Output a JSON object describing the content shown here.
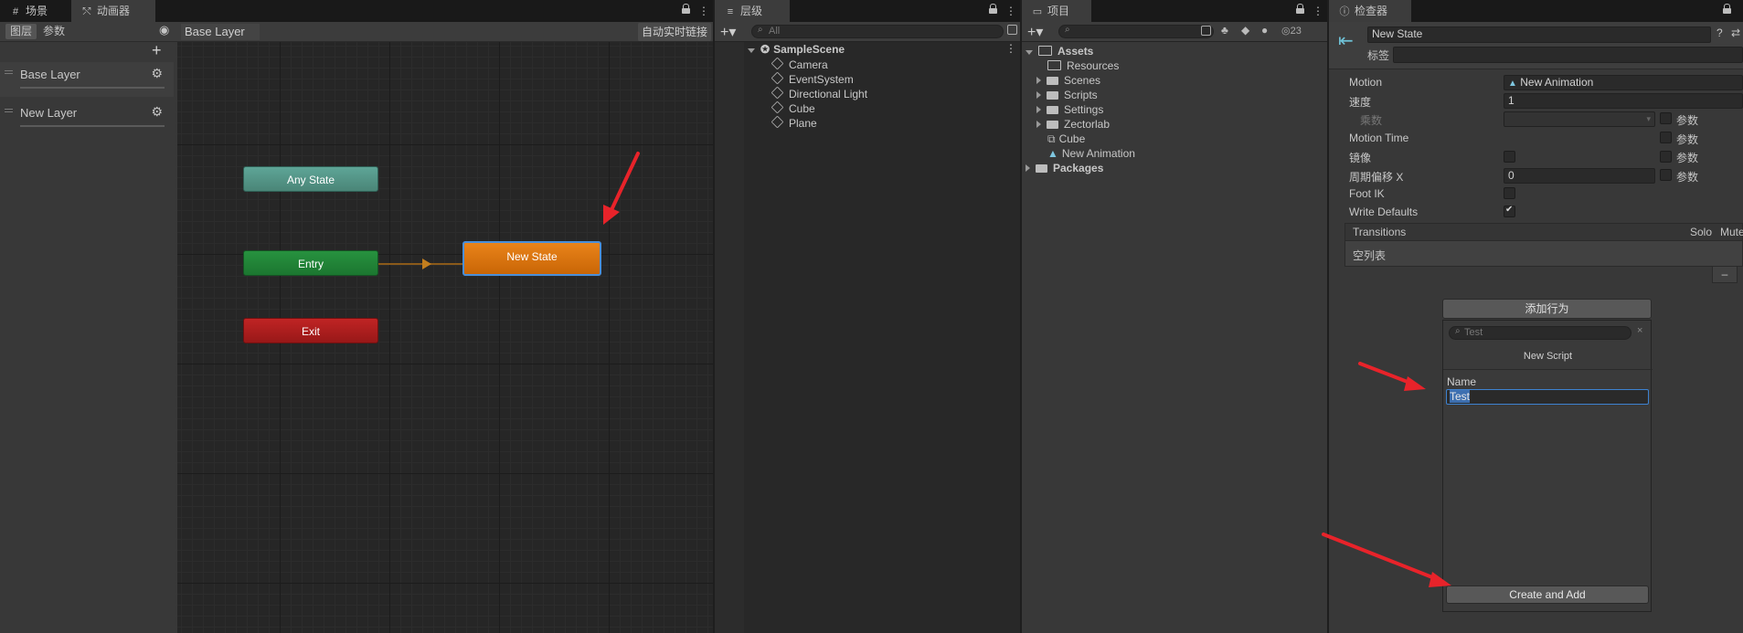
{
  "tabs": {
    "scene": "场景",
    "animator": "动画器",
    "hierarchy": "层级",
    "project": "项目",
    "inspector": "检查器"
  },
  "animator": {
    "subtab_layers": "图层",
    "subtab_params": "参数",
    "breadcrumb": "Base Layer",
    "live_link": "自动实时链接",
    "layers": [
      {
        "name": "Base Layer"
      },
      {
        "name": "New Layer"
      }
    ],
    "nodes": {
      "any_state": "Any State",
      "entry": "Entry",
      "exit": "Exit",
      "new_state": "New State"
    },
    "colors": {
      "any_state": "#4f8f82",
      "entry": "#1f7f36",
      "exit": "#a81c1c",
      "new_state": "#d9720b",
      "selection": "#4a8fd9"
    }
  },
  "hierarchy": {
    "search_placeholder": "All",
    "scene": "SampleScene",
    "items": [
      "Camera",
      "EventSystem",
      "Directional Light",
      "Cube",
      "Plane"
    ]
  },
  "project": {
    "root": "Assets",
    "items": [
      {
        "label": "Resources",
        "type": "folder",
        "expandable": false
      },
      {
        "label": "Scenes",
        "type": "folder",
        "expandable": true
      },
      {
        "label": "Scripts",
        "type": "folder",
        "expandable": true
      },
      {
        "label": "Settings",
        "type": "folder",
        "expandable": true
      },
      {
        "label": "Zectorlab",
        "type": "folder",
        "expandable": true
      },
      {
        "label": "Cube",
        "type": "prefab",
        "expandable": false
      },
      {
        "label": "New Animation",
        "type": "anim",
        "expandable": false
      }
    ],
    "packages": "Packages",
    "hidden_count": "23"
  },
  "inspector": {
    "name": "New State",
    "tag_label": "标签",
    "props": {
      "motion_label": "Motion",
      "motion_value": "New Animation",
      "speed_label": "速度",
      "speed_value": "1",
      "multiplier_label": "乘数",
      "param_label": "参数",
      "motion_time_label": "Motion Time",
      "mirror_label": "镜像",
      "cycle_offset_label": "周期偏移 X",
      "cycle_offset_value": "0",
      "foot_ik_label": "Foot IK",
      "write_defaults_label": "Write Defaults",
      "write_defaults_checked": true
    },
    "transitions": {
      "header": "Transitions",
      "solo": "Solo",
      "mute": "Mute",
      "empty": "空列表",
      "minus": "–"
    },
    "add_behaviour": "添加行为",
    "popup": {
      "search_value": "Test",
      "clear": "×",
      "title": "New Script",
      "name_label": "Name",
      "name_value": "Test",
      "create_button": "Create and Add"
    }
  },
  "annotation_color": "#e8232a"
}
